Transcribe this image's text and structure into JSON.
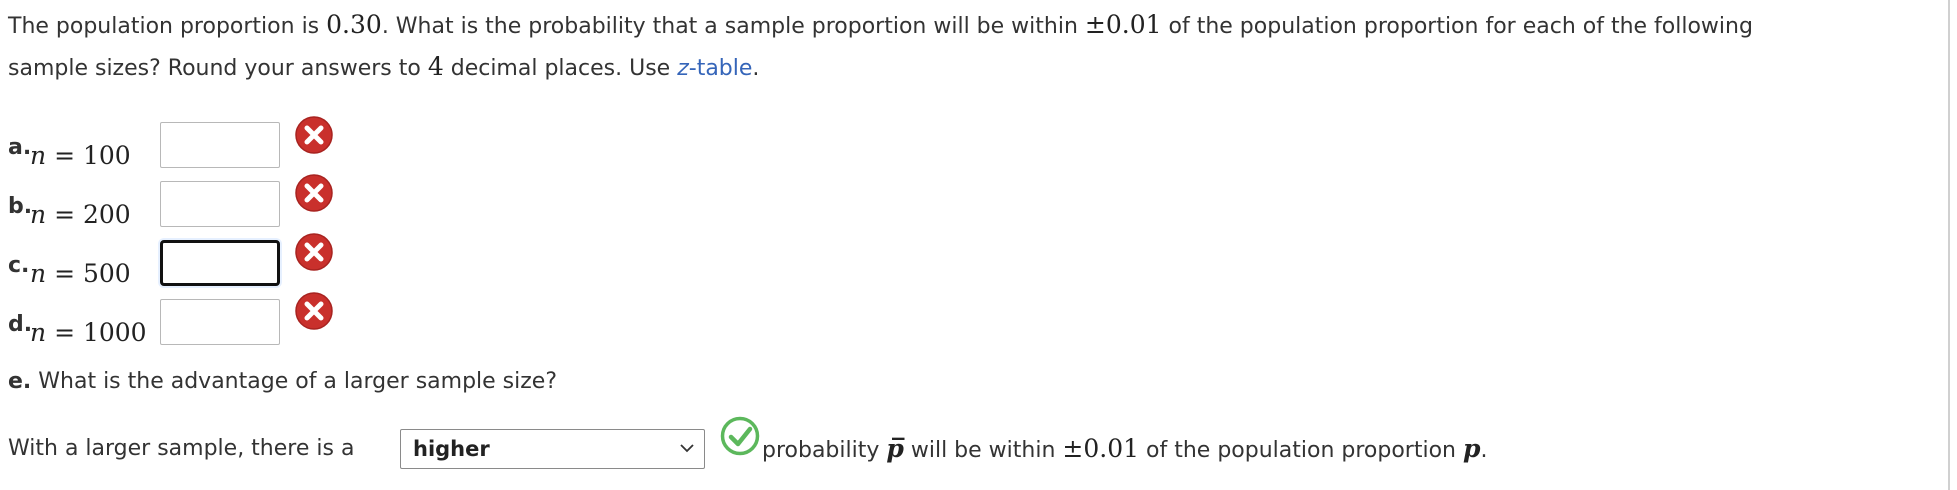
{
  "question": {
    "line1_prefix": "The population proportion is ",
    "proportion_value": "0.30",
    "line1_middle": ". What is the probability that a sample proportion will be within ",
    "pm_value": "±0.01",
    "line1_suffix": " of the population proportion for each of the following",
    "line2_prefix": "sample sizes? Round your answers to ",
    "decimal_places": "4",
    "line2_middle": " decimal places. Use ",
    "table_link_italic": "z",
    "table_link_rest": "-table",
    "line2_suffix": "."
  },
  "parts": [
    {
      "label": "a.",
      "var": "n",
      "equals": "=",
      "value": "100",
      "answer": "",
      "status": "incorrect"
    },
    {
      "label": "b.",
      "var": "n",
      "equals": "=",
      "value": "200",
      "answer": "",
      "status": "incorrect"
    },
    {
      "label": "c.",
      "var": "n",
      "equals": "=",
      "value": "500",
      "answer": "",
      "status": "incorrect"
    },
    {
      "label": "d.",
      "var": "n",
      "equals": "=",
      "value": "1000",
      "answer": "",
      "status": "incorrect"
    }
  ],
  "part_e": {
    "label": "e.",
    "question": " What is the advantage of a larger sample size?",
    "sentence_prefix": "With a larger sample, there is a ",
    "selected_option": "higher",
    "status": "correct",
    "sentence_middle": " probability ",
    "pbar": "p̅",
    "sentence_middle2": " will be within ",
    "pm_value": "±0.01",
    "sentence_suffix": " of the population proportion ",
    "p_var": "p",
    "period": "."
  },
  "colors": {
    "incorrect": "#c9302c",
    "correct": "#5cb85c",
    "link": "#3565b9"
  }
}
